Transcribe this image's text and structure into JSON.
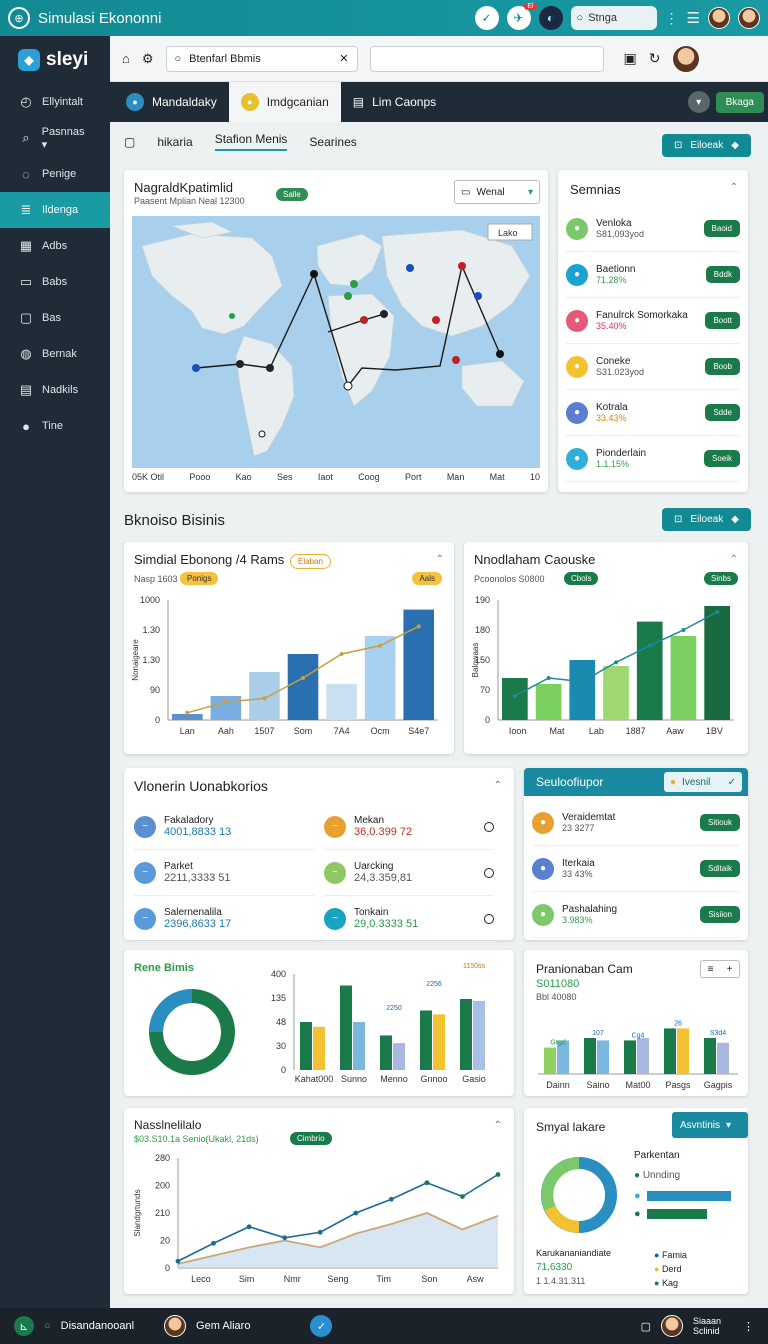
{
  "app": {
    "title": "Simulasi Ekononni",
    "brand": "sleyi",
    "top_badge": "El",
    "top_search": "Stnga"
  },
  "sidebar": {
    "items": [
      {
        "label": "Ellyintalt",
        "icon": "clock-icon"
      },
      {
        "label": "Pasnnas ▾",
        "icon": "search-icon"
      },
      {
        "label": "Penige",
        "icon": "chat-icon"
      },
      {
        "label": "Ildenga",
        "icon": "list-icon",
        "active": true
      },
      {
        "label": "Adbs",
        "icon": "grid-icon"
      },
      {
        "label": "Babs",
        "icon": "file-icon"
      },
      {
        "label": "Bas",
        "icon": "folder-icon"
      },
      {
        "label": "Bernak",
        "icon": "person-icon"
      },
      {
        "label": "Nadkils",
        "icon": "document-icon"
      },
      {
        "label": "Tine",
        "icon": "avatar-icon"
      }
    ]
  },
  "header": {
    "search_value": "Btenfarl Bbmis"
  },
  "tabs": [
    {
      "label": "Mandaldaky"
    },
    {
      "label": "Imdgcanian",
      "active": true
    },
    {
      "label": "Lim Caonps"
    }
  ],
  "tab_button": "Bkaga",
  "subtabs": [
    "hikaria",
    "Stafion Menis",
    "Searines"
  ],
  "action_button": "Eiloeak",
  "map_card": {
    "title": "NagraldKpatimlid",
    "subtitle": "Paasent Mplian Neal 12300",
    "pill": "Salle",
    "dropdown": "Wenal",
    "legend": "Lako",
    "x_labels": [
      "05K Otil",
      "Pooo",
      "Kao",
      "Ses",
      "Iaot",
      "Coog",
      "Port",
      "Man",
      "Mat",
      "10"
    ]
  },
  "services": {
    "title": "Semnias",
    "items": [
      {
        "name": "Venloka",
        "value": "S81,093yod",
        "color": "#7bc96a",
        "btn": "Baoid",
        "vcolor": "#555"
      },
      {
        "name": "Baetionn",
        "value": "71.28%",
        "color": "#1aa2d2",
        "btn": "Bddk",
        "vcolor": "#3a9c4a"
      },
      {
        "name": "Fanulrck Somorkaka",
        "value": "35.40%",
        "color": "#e5577c",
        "btn": "Boott",
        "vcolor": "#d2364e"
      },
      {
        "name": "Coneke",
        "value": "S31.023yod",
        "color": "#f2c230",
        "btn": "Boob",
        "vcolor": "#555"
      },
      {
        "name": "Kotrala",
        "value": "33.43%",
        "color": "#5a7fd0",
        "btn": "Sdde",
        "vcolor": "#d08a10"
      },
      {
        "name": "Pionderlain",
        "value": "1.1.15%",
        "color": "#30b0d8",
        "btn": "Soeik",
        "vcolor": "#3a9c4a"
      }
    ]
  },
  "section_title": "Bknoiso Bisinis",
  "section_button": "Eiloeak",
  "chart1": {
    "title": "Simdial Ebonong /4 Rams",
    "pill": "Elaban",
    "sub": "Nasp 1603",
    "pill2": "Ponigs",
    "pill3": "Aals"
  },
  "chart2": {
    "title": "Nnodlaham Caouske",
    "sub": "Pcoonolos S0800",
    "pill": "Cbols",
    "pill2": "Sinbs"
  },
  "vis_card": {
    "title": "Vlonerin Uonabkorios",
    "items": [
      {
        "name": "Fakaladory",
        "value": "4001,8833 13",
        "color": "#5a8fd0",
        "vcolor": "#1a7ab0"
      },
      {
        "name": "Mekan",
        "value": "36,0.399 72",
        "color": "#e8a030",
        "vcolor": "#c0302a"
      },
      {
        "name": "Parket",
        "value": "2211,3333 51",
        "color": "#5a9ad8",
        "vcolor": "#555"
      },
      {
        "name": "Uarcking",
        "value": "24,3.359,81",
        "color": "#8fc860",
        "vcolor": "#555"
      },
      {
        "name": "Salernenalila",
        "value": "2396,8633 17",
        "color": "#5a9ad8",
        "vcolor": "#1a7ab0"
      },
      {
        "name": "Tonkain",
        "value": "29,0.3333 51",
        "color": "#1aa2c2",
        "vcolor": "#2a9c4a"
      }
    ]
  },
  "supp_card": {
    "title": "Seuloofiupor",
    "dropdown": "Ivesnil",
    "items": [
      {
        "name": "Veraidemtat",
        "value": "23 3277",
        "color": "#e8a030",
        "btn": "Sitiouk",
        "vcolor": "#555"
      },
      {
        "name": "Iterkaia",
        "value": "33 43%",
        "color": "#5a7fd0",
        "btn": "Sditaik",
        "vcolor": "#555"
      },
      {
        "name": "Pashalahing",
        "value": "3.983%",
        "color": "#7bc96a",
        "btn": "Sisiion",
        "vcolor": "#3a9c4a"
      }
    ]
  },
  "donut_card": {
    "title": "Rene Bimis"
  },
  "fin_card": {
    "title": "Pranionaban Cam",
    "value": "S011080",
    "sub": "Bbl 40080"
  },
  "line_card": {
    "title": "Nasslnelilalo",
    "sub": "$03.S10.1a Senio(Ukakl, 21ds)",
    "pill": "Cimbrio"
  },
  "signal_card": {
    "title": "Smyal lakare",
    "dropdown": "Asvntinis",
    "legend_title": "Parkentan",
    "legend_sub": "Unnding",
    "footer_title": "Karukananiandiate",
    "footer_v1": "71,6330",
    "footer_v2": "1 1.4.31.311",
    "legend2": [
      "Famia",
      "Derd",
      "Kag"
    ]
  },
  "bottom": {
    "left": "Disandanooanl",
    "user": "Gem Aliaro",
    "right_user": "Siaaan Sclinid"
  },
  "chart_data": [
    {
      "type": "bar",
      "categories": [
        "Lan",
        "Aah",
        "1507",
        "Som",
        "7A4",
        "Ocm",
        "S4e7"
      ],
      "values": [
        5,
        20,
        40,
        55,
        30,
        70,
        92
      ],
      "line": [
        6,
        15,
        18,
        35,
        55,
        62,
        78
      ],
      "y_ticks": [
        "1000",
        "1.30",
        "1.30",
        "90",
        "0"
      ],
      "ylabel": "Nonaigeare"
    },
    {
      "type": "bar",
      "categories": [
        "Ioon",
        "Mat",
        "Lab",
        "1887",
        "Aaw",
        "1BV"
      ],
      "values": [
        35,
        30,
        50,
        45,
        82,
        70,
        95
      ],
      "line": [
        20,
        35,
        32,
        48,
        62,
        75,
        90
      ],
      "y_ticks": [
        "190",
        "180",
        "150",
        "70",
        "0"
      ],
      "ylabel": "Balowaas"
    },
    {
      "type": "bar",
      "categories": [
        "Kahat000",
        "Sunno",
        "Menno",
        "Gnnoo",
        "Gasio"
      ],
      "y_ticks": [
        "400",
        "135",
        "48",
        "30",
        "0"
      ],
      "labels": [
        "1150ss",
        "2256",
        "2250"
      ],
      "series": [
        {
          "name": "a",
          "values": [
            50,
            88,
            36,
            62,
            74
          ]
        },
        {
          "name": "b",
          "values": [
            45,
            50,
            28,
            58,
            72
          ]
        }
      ]
    },
    {
      "type": "bar",
      "categories": [
        "Dainn",
        "Saino",
        "Mat00",
        "Pasgs",
        "Gagpis"
      ],
      "labels": [
        "Grgd",
        "107",
        "Cg4",
        "26",
        "S3d4"
      ],
      "series": [
        {
          "values": [
            22,
            30,
            28,
            38,
            30
          ]
        },
        {
          "values": [
            28,
            28,
            30,
            38,
            26
          ]
        }
      ]
    },
    {
      "type": "line",
      "x": [
        "Leco",
        "Sim",
        "Nmr",
        "Seng",
        "Tim",
        "Son",
        "Asw"
      ],
      "y_ticks": [
        "280",
        "200",
        "210",
        "20",
        "0"
      ],
      "ylabel": "Slandgrtunds",
      "series": [
        {
          "values": [
            5,
            18,
            30,
            22,
            26,
            40,
            50,
            62,
            52,
            68
          ]
        },
        {
          "values": [
            3,
            9,
            15,
            20,
            15,
            25,
            32,
            40,
            28,
            38
          ]
        }
      ]
    },
    {
      "type": "pie",
      "values": [
        60,
        25,
        15
      ]
    }
  ]
}
